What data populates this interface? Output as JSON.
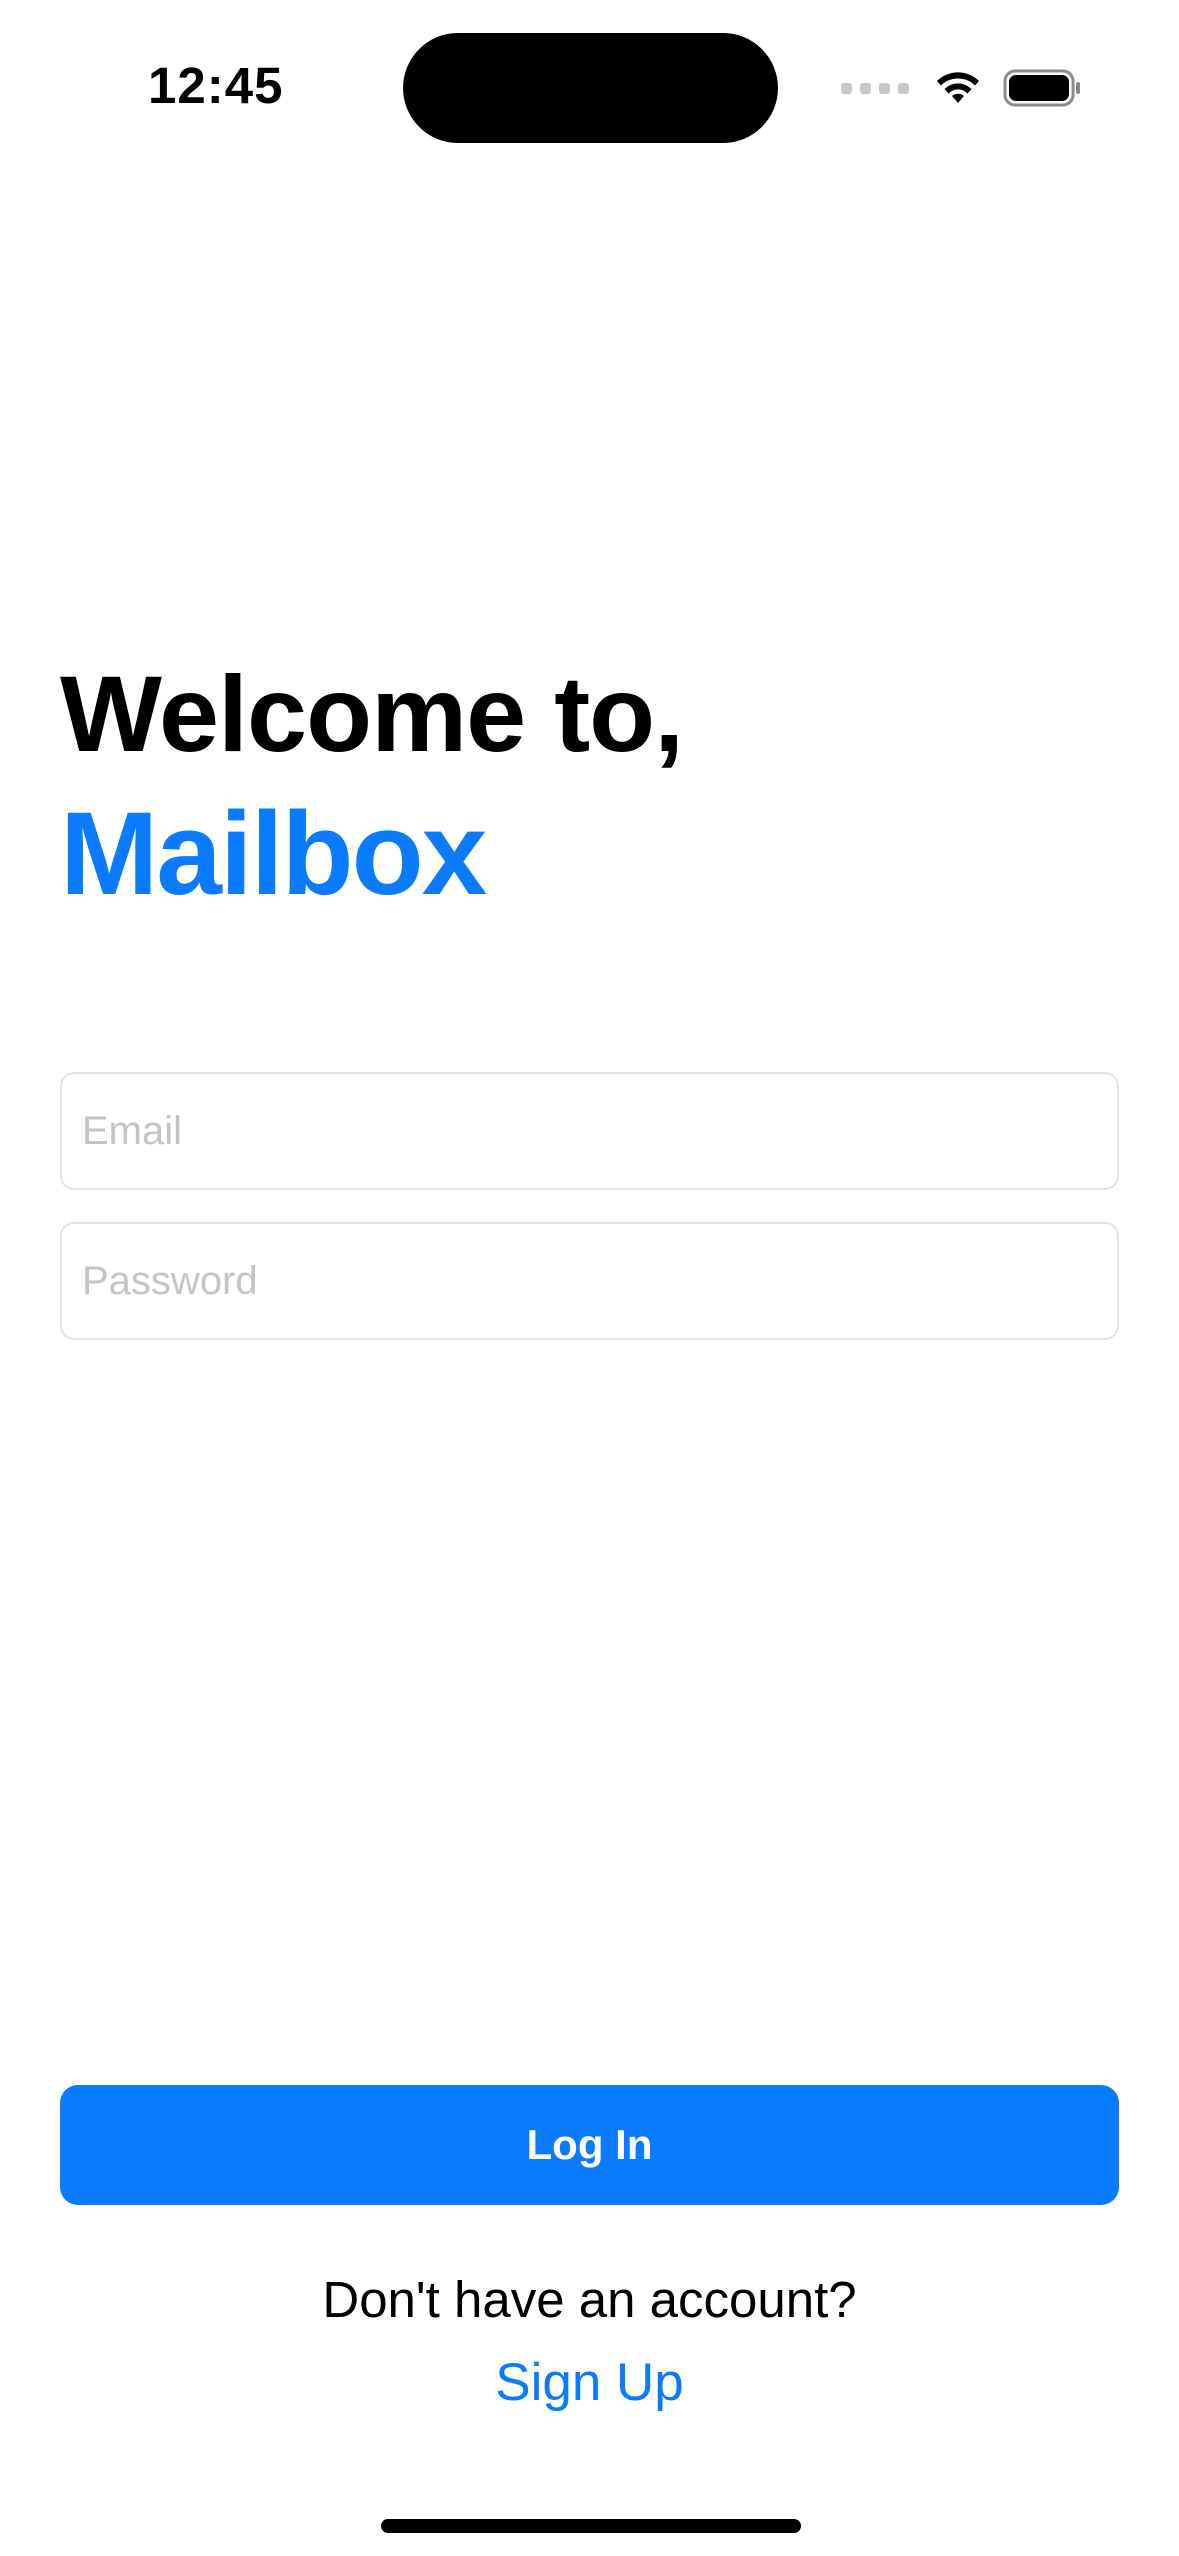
{
  "status_bar": {
    "time": "12:45",
    "icons": [
      "cellular-signal-icon",
      "wifi-icon",
      "battery-icon"
    ]
  },
  "welcome": {
    "line1": "Welcome to,",
    "app_name": "Mailbox"
  },
  "form": {
    "email": {
      "value": "",
      "placeholder": "Email"
    },
    "password": {
      "value": "",
      "placeholder": "Password"
    }
  },
  "actions": {
    "login_label": "Log In",
    "no_account_text": "Don't have an account?",
    "signup_label": "Sign Up"
  },
  "colors": {
    "accent": "#0a7aff",
    "text": "#000000",
    "placeholder": "#c4c4c7",
    "field_border": "#e3e3e6",
    "background": "#ffffff"
  }
}
